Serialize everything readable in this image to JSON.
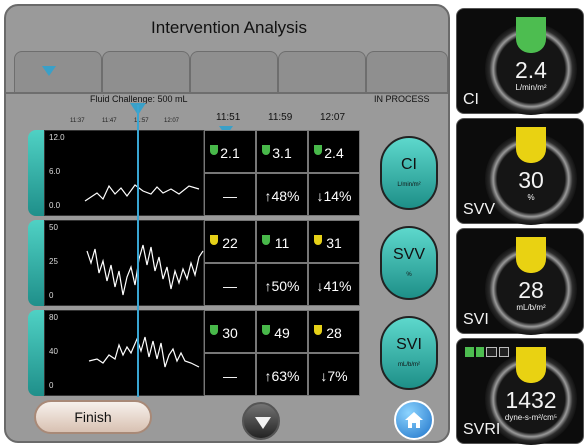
{
  "header": {
    "title": "Intervention Analysis",
    "process_status": "IN PROCESS"
  },
  "event": {
    "label": "Fluid Challenge: 500 mL"
  },
  "timeline": {
    "small_times": [
      "11:37",
      "11:47",
      "11:57",
      "12:07"
    ],
    "big_times": [
      "11:51",
      "11:59",
      "12:07"
    ]
  },
  "rows": [
    {
      "name": "CI",
      "unit": "L/min/m²",
      "yticks": [
        "12.0",
        "6.0",
        "0.0"
      ],
      "values": [
        {
          "val": "2.1",
          "status": "green",
          "pct": "—"
        },
        {
          "val": "3.1",
          "status": "green",
          "pct": "↑48%"
        },
        {
          "val": "2.4",
          "status": "green",
          "pct": "↓14%"
        }
      ]
    },
    {
      "name": "SVV",
      "unit": "%",
      "yticks": [
        "50",
        "25",
        "0"
      ],
      "values": [
        {
          "val": "22",
          "status": "yellow",
          "pct": "—"
        },
        {
          "val": "11",
          "status": "green",
          "pct": "↑50%"
        },
        {
          "val": "31",
          "status": "yellow",
          "pct": "↓41%"
        }
      ]
    },
    {
      "name": "SVI",
      "unit": "mL/b/m²",
      "yticks": [
        "80",
        "40",
        "0"
      ],
      "values": [
        {
          "val": "30",
          "status": "green",
          "pct": "—"
        },
        {
          "val": "49",
          "status": "green",
          "pct": "↑63%"
        },
        {
          "val": "28",
          "status": "yellow",
          "pct": "↓7%"
        }
      ]
    }
  ],
  "buttons": {
    "finish_label": "Finish"
  },
  "side": [
    {
      "name": "CI",
      "value": "2.4",
      "unit": "L/min/m²",
      "color": "#4dbd50"
    },
    {
      "name": "SVV",
      "value": "30",
      "unit": "%",
      "color": "#e9d212"
    },
    {
      "name": "SVI",
      "value": "28",
      "unit": "mL/b/m²",
      "color": "#e9d212"
    },
    {
      "name": "SVRI",
      "value": "1432",
      "unit": "dyne-s-m²/cm⁵",
      "color": "#e9d212"
    }
  ]
}
